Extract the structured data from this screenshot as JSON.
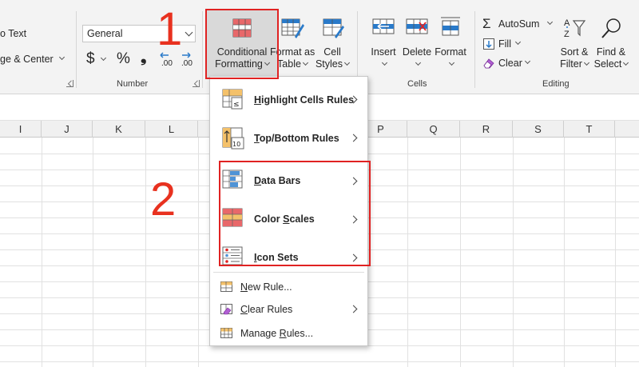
{
  "ribbon": {
    "alignment": {
      "wrap_text": "o Text",
      "merge_center": "ge & Center"
    },
    "number": {
      "format_value": "General",
      "currency_symbol": "$",
      "percent_symbol": "%",
      "comma_symbol": "❟",
      "increase_decimal": ".00",
      "decrease_decimal": ".00",
      "group_label": "Number"
    },
    "styles": {
      "conditional_formatting": [
        "Conditional",
        "Formatting"
      ],
      "format_as_table": [
        "Format as",
        "Table"
      ],
      "cell_styles": [
        "Cell",
        "Styles"
      ]
    },
    "cells": {
      "insert": "Insert",
      "delete": "Delete",
      "format": "Format",
      "group_label": "Cells"
    },
    "editing": {
      "autosum": "AutoSum",
      "fill": "Fill",
      "clear": "Clear",
      "sort_filter": [
        "Sort &",
        "Filter"
      ],
      "find_select": [
        "Find &",
        "Select"
      ],
      "group_label": "Editing"
    }
  },
  "annotations": {
    "step_one": "1",
    "step_two": "2"
  },
  "columns": [
    "I",
    "J",
    "K",
    "L",
    "P",
    "Q",
    "R",
    "S",
    "T"
  ],
  "menu": {
    "items": [
      {
        "label": "Highlight Cells Rules",
        "underline": "H",
        "rest": "ighlight Cells Rules"
      },
      {
        "label": "Top/Bottom Rules",
        "underline": "T",
        "rest": "op/Bottom Rules"
      },
      {
        "label": "Data Bars",
        "underline": "D",
        "rest": "ata Bars"
      },
      {
        "label": "Color Scales",
        "pre": "Color ",
        "underline": "S",
        "rest": "cales"
      },
      {
        "label": "Icon Sets",
        "underline": "I",
        "rest": "con Sets"
      }
    ],
    "actions": [
      {
        "underline": "N",
        "rest": "ew Rule..."
      },
      {
        "underline": "C",
        "rest": "lear Rules"
      },
      {
        "pre": "Manage ",
        "underline": "R",
        "rest": "ules..."
      }
    ]
  },
  "colors": {
    "highlight_red": "#e02222",
    "ribbon_bg": "#f3f3f3",
    "selected_bg": "#d9d9d9"
  }
}
